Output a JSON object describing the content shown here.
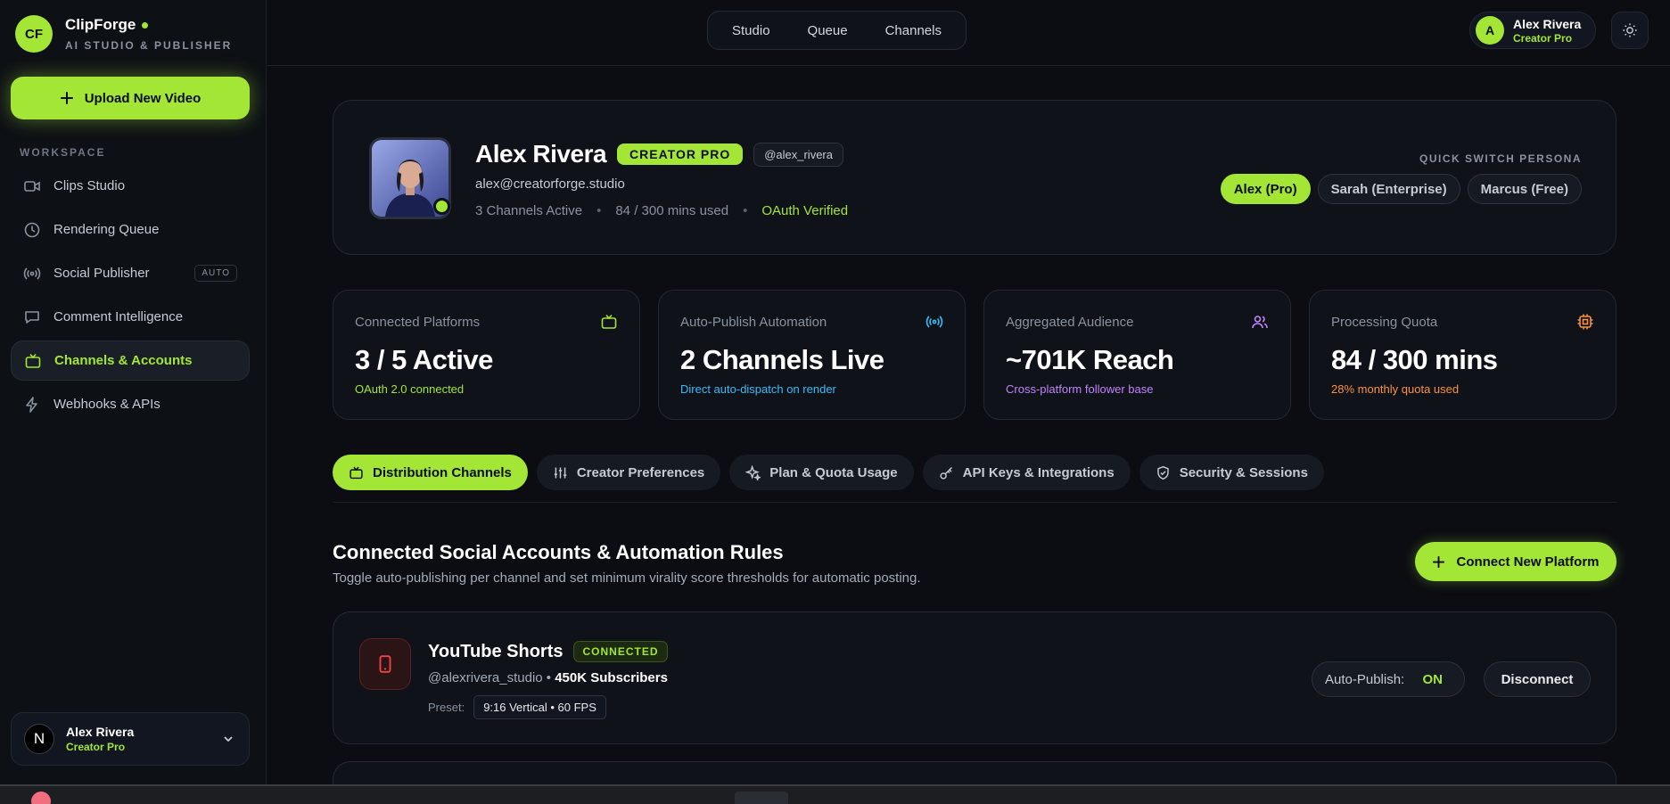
{
  "brand": {
    "logo_text": "CF",
    "name": "ClipForge",
    "subtitle": "AI STUDIO & PUBLISHER",
    "accent_color": "#a3e635"
  },
  "sidebar": {
    "upload_label": "Upload New Video",
    "workspace_label": "WORKSPACE",
    "items": [
      {
        "label": "Clips Studio",
        "icon": "video-camera-icon"
      },
      {
        "label": "Rendering Queue",
        "icon": "clock-icon"
      },
      {
        "label": "Social Publisher",
        "icon": "broadcast-icon",
        "badge": "AUTO"
      },
      {
        "label": "Comment Intelligence",
        "icon": "chat-icon"
      },
      {
        "label": "Channels & Accounts",
        "icon": "tv-icon",
        "active": true
      },
      {
        "label": "Webhooks & APIs",
        "icon": "bolt-icon"
      }
    ],
    "user": {
      "avatar": "N",
      "name": "Alex Rivera",
      "plan": "Creator Pro"
    }
  },
  "topbar": {
    "tabs": [
      "Studio",
      "Queue",
      "Channels"
    ],
    "user": {
      "avatar": "A",
      "name": "Alex Rivera",
      "plan": "Creator Pro"
    }
  },
  "profile": {
    "name": "Alex Rivera",
    "badge": "CREATOR PRO",
    "handle": "@alex_rivera",
    "email": "alex@creatorforge.studio",
    "meta": [
      "3 Channels Active",
      "84 / 300 mins used",
      "OAuth Verified"
    ],
    "quick_switch_label": "QUICK SWITCH PERSONA",
    "personas": [
      "Alex (Pro)",
      "Sarah (Enterprise)",
      "Marcus (Free)"
    ]
  },
  "stats": [
    {
      "label": "Connected Platforms",
      "value": "3 / 5 Active",
      "sub": "OAuth 2.0 connected",
      "color": "#a3e635",
      "icon": "tv-icon"
    },
    {
      "label": "Auto-Publish Automation",
      "value": "2 Channels Live",
      "sub": "Direct auto-dispatch on render",
      "color": "#38bdf8",
      "icon": "broadcast-icon"
    },
    {
      "label": "Aggregated Audience",
      "value": "~701K Reach",
      "sub": "Cross-platform follower base",
      "color": "#c084fc",
      "icon": "users-icon"
    },
    {
      "label": "Processing Quota",
      "value": "84 / 300 mins",
      "sub": "28% monthly quota used",
      "color": "#fb923c",
      "icon": "cpu-icon"
    }
  ],
  "section_tabs": [
    {
      "label": "Distribution Channels",
      "icon": "tv-icon",
      "active": true
    },
    {
      "label": "Creator Preferences",
      "icon": "sliders-icon"
    },
    {
      "label": "Plan & Quota Usage",
      "icon": "sparkle-icon"
    },
    {
      "label": "API Keys & Integrations",
      "icon": "key-icon"
    },
    {
      "label": "Security & Sessions",
      "icon": "shield-icon"
    }
  ],
  "accounts": {
    "title": "Connected Social Accounts & Automation Rules",
    "subtitle": "Toggle auto-publishing per channel and set minimum virality score thresholds for automatic posting.",
    "connect_label": "Connect New Platform",
    "channels": [
      {
        "name": "YouTube Shorts",
        "status": "CONNECTED",
        "handle": "@alexrivera_studio",
        "separator": " • ",
        "followers": "450K Subscribers",
        "preset_label": "Preset:",
        "preset": "9:16 Vertical • 60 FPS",
        "auto_publish_label": "Auto-Publish:",
        "auto_publish_value": "ON",
        "disconnect_label": "Disconnect",
        "icon": "phone-icon",
        "color": "#ef4444"
      }
    ]
  }
}
